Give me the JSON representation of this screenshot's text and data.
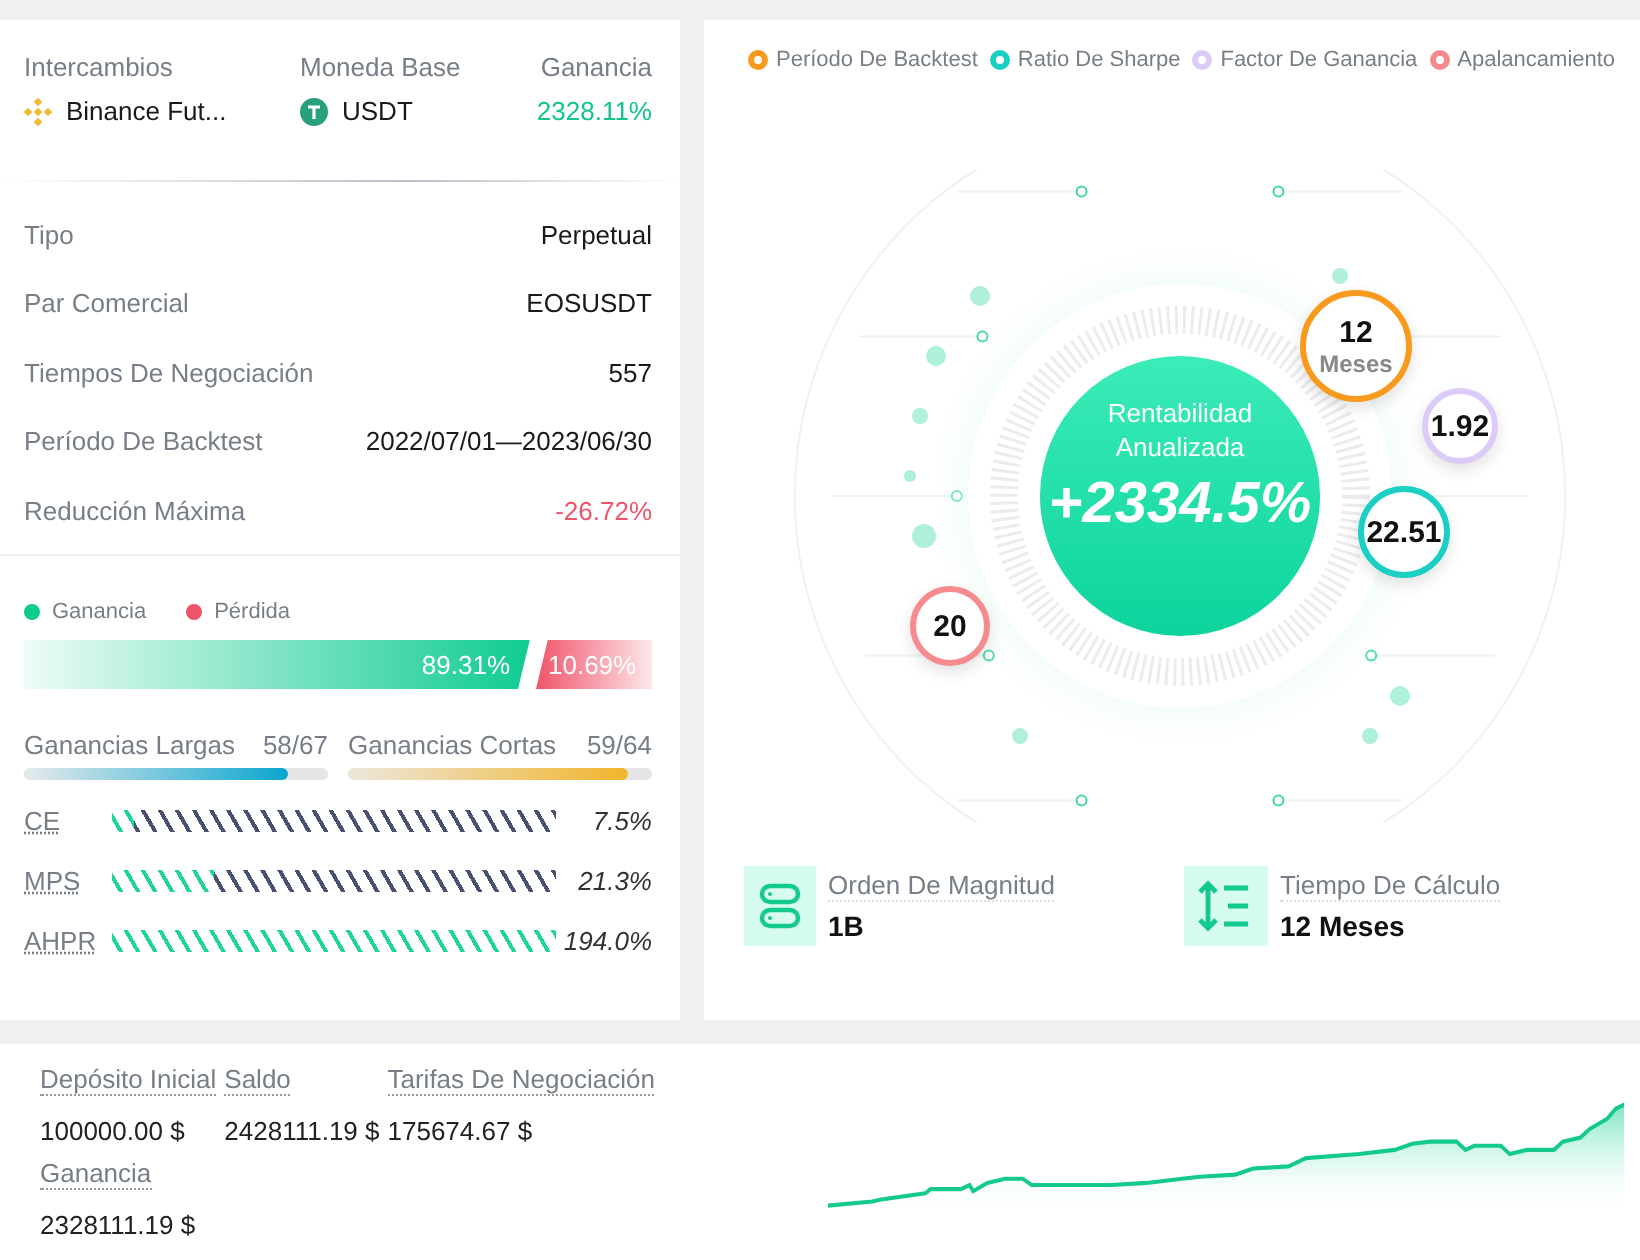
{
  "summary": {
    "columns": [
      {
        "label": "Intercambios",
        "value": "Binance Fut...",
        "kind": "exchange"
      },
      {
        "label": "Moneda Base",
        "value": "USDT",
        "kind": "coin"
      },
      {
        "label": "Ganancia",
        "value": "2328.11%",
        "kind": "profit"
      }
    ]
  },
  "details": [
    {
      "label": "Tipo",
      "value": "Perpetual",
      "kind": "plain"
    },
    {
      "label": "Par Comercial",
      "value": "EOSUSDT",
      "kind": "plain"
    },
    {
      "label": "Tiempos De Negociación",
      "value": "557",
      "kind": "plain"
    },
    {
      "label": "Período De Backtest",
      "value": "2022/07/01—2023/06/30",
      "kind": "plain"
    },
    {
      "label": "Reducción Máxima",
      "value": "-26.72%",
      "kind": "loss"
    }
  ],
  "win_loss": {
    "legend": [
      {
        "label": "Ganancia",
        "color": "#10c98f"
      },
      {
        "label": "Pérdida",
        "color": "#f0546a"
      }
    ],
    "win": {
      "text": "89.31%"
    },
    "loss": {
      "text": "10.69%"
    }
  },
  "long_short": [
    {
      "label": "Ganancias Largas",
      "count": "58/67",
      "level": 0.866,
      "kind": "long"
    },
    {
      "label": "Ganancias Cortas",
      "count": "59/64",
      "level": 0.922,
      "kind": "short"
    }
  ],
  "meters": [
    {
      "label": "CE",
      "reading": "7.5%",
      "level": 0.05
    },
    {
      "label": "MPS",
      "reading": "21.3%",
      "level": 0.23
    },
    {
      "label": "AHPR",
      "reading": "194.0%",
      "level": 1
    }
  ],
  "legend": [
    {
      "label": "Período De Backtest",
      "color": "#f79a1e"
    },
    {
      "label": "Ratio De Sharpe",
      "color": "#1ccfc4"
    },
    {
      "label": "Factor De Ganancia",
      "color": "#dccbf8"
    },
    {
      "label": "Apalancamiento",
      "color": "#f58a8f"
    }
  ],
  "center": {
    "title": "Rentabilidad Anualizada",
    "value": "+2334.5%"
  },
  "bubbles": [
    {
      "value": "12",
      "unit": "Meses",
      "color": "#f79a1e"
    },
    {
      "value": "1.92",
      "color": "#dccbf8"
    },
    {
      "value": "22.51",
      "color": "#1ccfc4"
    },
    {
      "value": "20",
      "color": "#f58a8f"
    }
  ],
  "info": [
    {
      "label": "Orden De Magnitud",
      "value": "1B",
      "kind": "stack"
    },
    {
      "label": "Tiempo De Cálculo",
      "value": "12 Meses",
      "kind": "sort"
    }
  ],
  "account": [
    {
      "label": "Depósito Inicial",
      "value": "100000.00 $"
    },
    {
      "label": "Saldo",
      "value": "2428111.19 $"
    },
    {
      "label": "Tarifas De Negociación",
      "value": "175674.67 $"
    },
    {
      "label": "Ganancia",
      "value": "2328111.19 $"
    }
  ]
}
